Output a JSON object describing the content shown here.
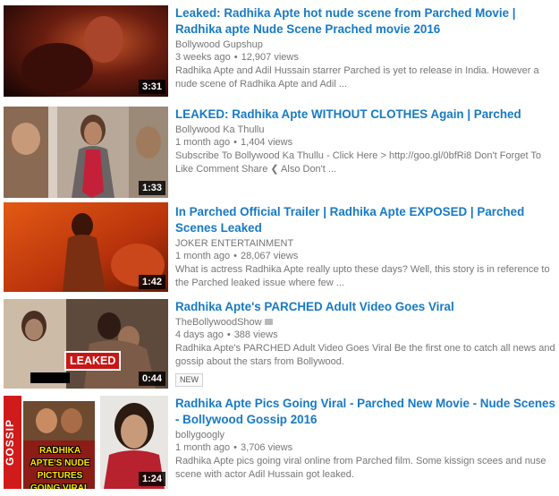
{
  "results": [
    {
      "title": "Leaked: Radhika Apte hot nude scene from Parched Movie | Radhika apte Nude Scene Prached movie 2016",
      "channel": "Bollywood Gupshup",
      "age": "3 weeks ago",
      "views": "12,907 views",
      "description": "Radhika Apte and Adil Hussain starrer Parched is yet to release in India. However a nude scene of Radhika Apte and Adil ...",
      "duration": "3:31"
    },
    {
      "title": "LEAKED: Radhika Apte WITHOUT CLOTHES Again | Parched",
      "channel": "Bollywood Ka Thullu",
      "age": "1 month ago",
      "views": "1,404 views",
      "description": "Subscribe To Bollywood Ka Thullu - Click Here > http://goo.gl/0bfRi8 Don't Forget To Like Comment Share ❮ Also Don't ...",
      "duration": "1:33"
    },
    {
      "title": "In Parched Official Trailer | Radhika Apte EXPOSED | Parched Scenes Leaked",
      "channel": "JOKER ENTERTAINMENT",
      "age": "1 month ago",
      "views": "28,067 views",
      "description": "What is actress Radhika Apte really upto these days? Well, this story is in reference to the Parched leaked issue where few ...",
      "duration": "1:42"
    },
    {
      "title": "Radhika Apte's PARCHED Adult Video Goes Viral",
      "channel": "TheBollywoodShow",
      "age": "4 days ago",
      "views": "388 views",
      "description": "Radhika Apte's PARCHED Adult Video Goes Viral Be the first one to catch all news and gossip about the stars from Bollywood.",
      "duration": "0:44",
      "badge": "NEW",
      "overlay_text": "LEAKED"
    },
    {
      "title": "Radhika Apte Pics Going Viral - Parched New Movie - Nude Scenes - Bollywood Gossip 2016",
      "channel": "bollygoogly",
      "age": "1 month ago",
      "views": "3,706 views",
      "description": "Radhika Apte pics going viral online from Parched film. Some kissign scees and nuse scene with actor Adil Hussain got leaked.",
      "duration": "1:24",
      "side_text": "GOSSIP",
      "caption": "RADHIKA APTE'S NUDE PICTURES GOING VIRAL"
    }
  ],
  "separator": "•",
  "colors": {
    "title": "#167ac6",
    "meta": "#767676",
    "leaked_red": "#c91616"
  }
}
